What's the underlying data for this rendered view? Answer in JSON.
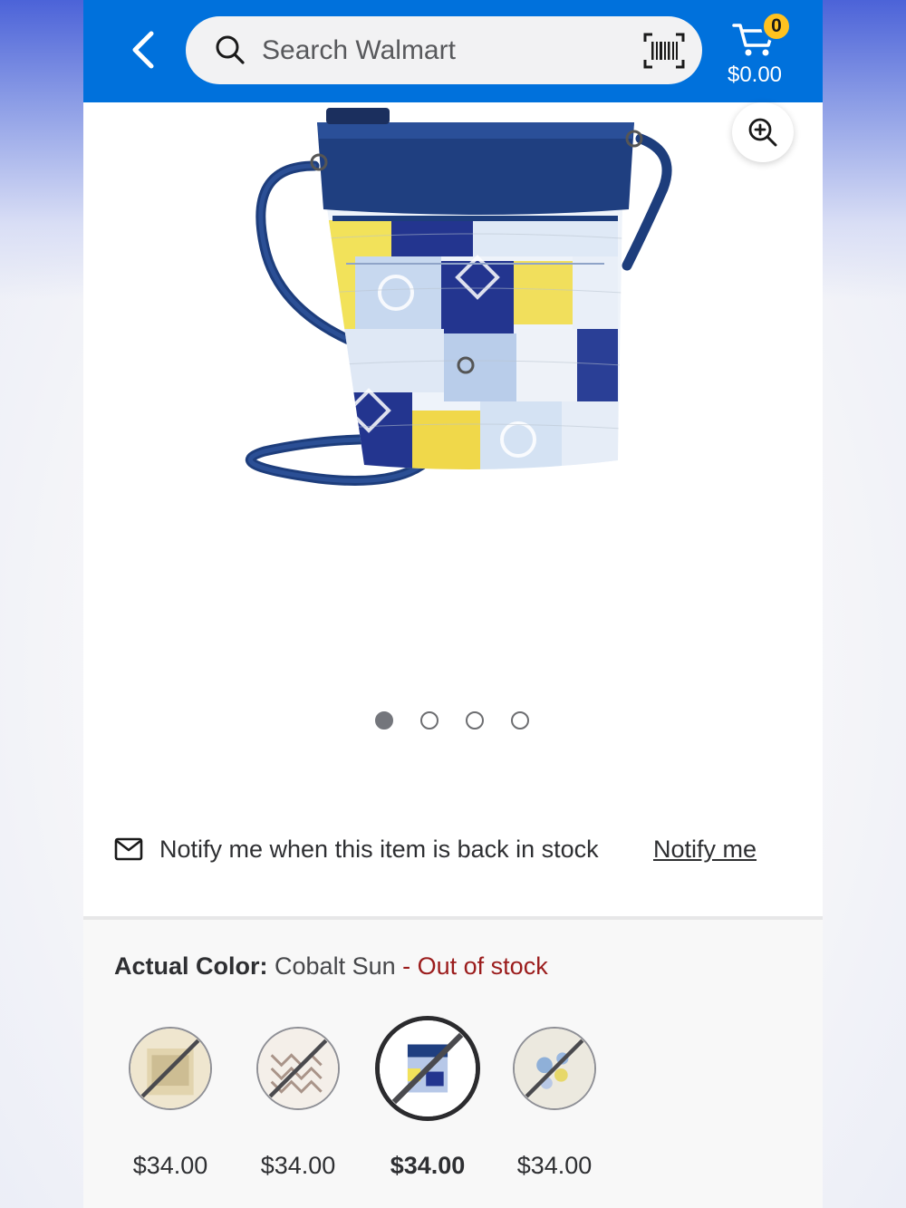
{
  "header": {
    "search_placeholder": "Search Walmart",
    "cart_count": "0",
    "cart_total": "$0.00",
    "brand_color": "#0071dc"
  },
  "gallery": {
    "image_count": 4,
    "active_index": 0
  },
  "notify": {
    "text": "Notify me when this item is back in stock",
    "link": "Notify me"
  },
  "variant": {
    "label": "Actual Color:",
    "value": "Cobalt Sun",
    "status": "- Out of stock",
    "status_color": "#9b1c1c",
    "options": [
      {
        "price": "$34.00",
        "selected": false,
        "out_of_stock": true
      },
      {
        "price": "$34.00",
        "selected": false,
        "out_of_stock": true
      },
      {
        "price": "$34.00",
        "selected": true,
        "out_of_stock": true
      },
      {
        "price": "$34.00",
        "selected": false,
        "out_of_stock": true
      }
    ]
  }
}
